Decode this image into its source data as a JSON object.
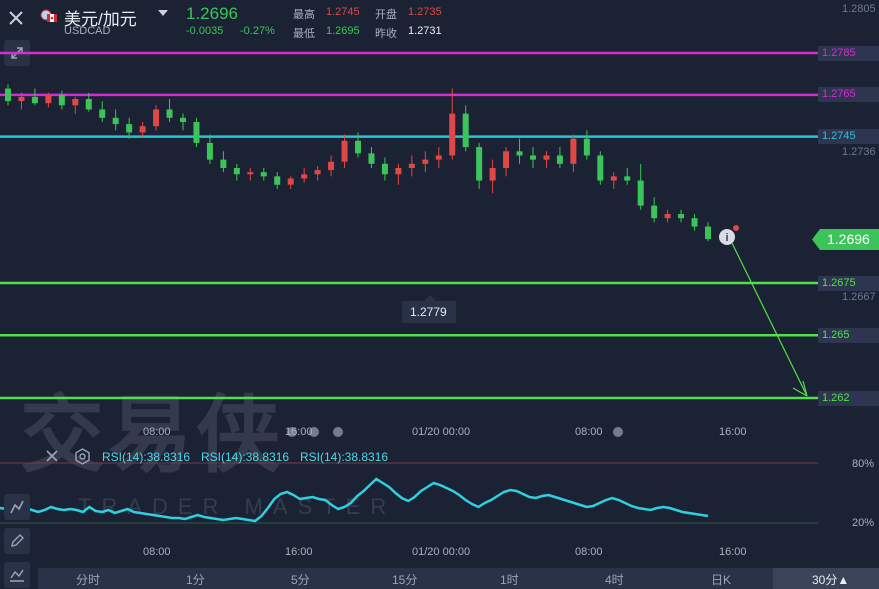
{
  "header": {
    "pair_name": "美元/加元",
    "pair_code": "USDCAD",
    "last_price": "1.2696",
    "change": "-0.0035",
    "change_pct": "-0.27%",
    "high_label": "最高",
    "high_value": "1.2745",
    "open_label": "开盘",
    "open_value": "1.2735",
    "low_label": "最低",
    "low_value": "1.2695",
    "prev_close_label": "昨收",
    "prev_close_value": "1.2731"
  },
  "price_axis": {
    "top_label": "1.2805",
    "labels": [
      {
        "text": "1.2785",
        "color": "#d62bd1"
      },
      {
        "text": "1.2765",
        "color": "#d62bd1"
      },
      {
        "text": "1.2745",
        "color": "#26c5d6"
      },
      {
        "text": "1.2736",
        "color": "#6e7890"
      },
      {
        "text": "1.2696",
        "color": "#3cc45a"
      },
      {
        "text": "1.2675",
        "color": "#3cc45a"
      },
      {
        "text": "1.2667",
        "color": "#6e7890"
      },
      {
        "text": "1.265",
        "color": "#3cc45a"
      },
      {
        "text": "1.262",
        "color": "#3cc45a"
      }
    ]
  },
  "tooltip_price": "1.2779",
  "time_axis_main": [
    "08:00",
    "16:00",
    "01/20 00:00",
    "08:00",
    "16:00"
  ],
  "time_axis_rsi": [
    "08:00",
    "16:00",
    "01/20 00:00",
    "08:00",
    "16:00"
  ],
  "rsi": {
    "labels": [
      "RSI(14):38.8316",
      "RSI(14):38.8316",
      "RSI(14):38.8316"
    ],
    "level_high": "80%",
    "level_low": "20%"
  },
  "watermark": {
    "main": "交易侠",
    "sub": "TRADER MASTER"
  },
  "timeframes": [
    "分时",
    "1分",
    "5分",
    "15分",
    "1时",
    "4时",
    "日K",
    "30分▲"
  ],
  "colors": {
    "magenta": "#d62bd1",
    "cyan": "#26c5d6",
    "green": "#52e04a",
    "up": "#3cc45a",
    "down": "#e04848"
  },
  "chart_data": {
    "type": "candlestick",
    "candles_ohlc": [
      [
        1.2768,
        1.277,
        1.276,
        1.2762
      ],
      [
        1.2762,
        1.2766,
        1.2758,
        1.2764
      ],
      [
        1.2764,
        1.2768,
        1.276,
        1.2761
      ],
      [
        1.2761,
        1.2766,
        1.2759,
        1.2765
      ],
      [
        1.2765,
        1.2767,
        1.2758,
        1.276
      ],
      [
        1.276,
        1.2764,
        1.2756,
        1.2763
      ],
      [
        1.2763,
        1.2766,
        1.2757,
        1.2758
      ],
      [
        1.2758,
        1.2762,
        1.2752,
        1.2754
      ],
      [
        1.2754,
        1.2758,
        1.2748,
        1.2751
      ],
      [
        1.2751,
        1.2754,
        1.2744,
        1.2747
      ],
      [
        1.2747,
        1.2752,
        1.2745,
        1.275
      ],
      [
        1.275,
        1.276,
        1.2748,
        1.2758
      ],
      [
        1.2758,
        1.2763,
        1.2752,
        1.2754
      ],
      [
        1.2754,
        1.2756,
        1.2748,
        1.2752
      ],
      [
        1.2752,
        1.2754,
        1.274,
        1.2742
      ],
      [
        1.2742,
        1.2746,
        1.2732,
        1.2734
      ],
      [
        1.2734,
        1.2738,
        1.2728,
        1.273
      ],
      [
        1.273,
        1.2732,
        1.2724,
        1.2727
      ],
      [
        1.2727,
        1.273,
        1.2724,
        1.2728
      ],
      [
        1.2728,
        1.273,
        1.2724,
        1.2726
      ],
      [
        1.2726,
        1.2728,
        1.272,
        1.2722
      ],
      [
        1.2722,
        1.2726,
        1.272,
        1.2725
      ],
      [
        1.2725,
        1.273,
        1.2723,
        1.2727
      ],
      [
        1.2727,
        1.2731,
        1.2724,
        1.2729
      ],
      [
        1.2729,
        1.2736,
        1.2726,
        1.2733
      ],
      [
        1.2733,
        1.2746,
        1.273,
        1.2743
      ],
      [
        1.2743,
        1.2747,
        1.2735,
        1.2737
      ],
      [
        1.2737,
        1.274,
        1.273,
        1.2732
      ],
      [
        1.2732,
        1.2735,
        1.2724,
        1.2727
      ],
      [
        1.2727,
        1.2732,
        1.2722,
        1.273
      ],
      [
        1.273,
        1.2736,
        1.2726,
        1.2732
      ],
      [
        1.2732,
        1.2738,
        1.2728,
        1.2734
      ],
      [
        1.2734,
        1.274,
        1.273,
        1.2736
      ],
      [
        1.2736,
        1.2768,
        1.2734,
        1.2756
      ],
      [
        1.2756,
        1.276,
        1.2738,
        1.274
      ],
      [
        1.274,
        1.2742,
        1.272,
        1.2724
      ],
      [
        1.2724,
        1.2734,
        1.2718,
        1.273
      ],
      [
        1.273,
        1.274,
        1.2726,
        1.2738
      ],
      [
        1.2738,
        1.2744,
        1.2732,
        1.2736
      ],
      [
        1.2736,
        1.274,
        1.273,
        1.2734
      ],
      [
        1.2734,
        1.2738,
        1.273,
        1.2736
      ],
      [
        1.2736,
        1.274,
        1.273,
        1.2732
      ],
      [
        1.2732,
        1.2746,
        1.2728,
        1.2744
      ],
      [
        1.2744,
        1.2748,
        1.2734,
        1.2736
      ],
      [
        1.2736,
        1.2738,
        1.2722,
        1.2724
      ],
      [
        1.2724,
        1.2728,
        1.272,
        1.2726
      ],
      [
        1.2726,
        1.273,
        1.2722,
        1.2724
      ],
      [
        1.2724,
        1.2732,
        1.271,
        1.2712
      ],
      [
        1.2712,
        1.2716,
        1.2704,
        1.2706
      ],
      [
        1.2706,
        1.271,
        1.2704,
        1.2708
      ],
      [
        1.2708,
        1.271,
        1.2704,
        1.2706
      ],
      [
        1.2706,
        1.2708,
        1.27,
        1.2702
      ],
      [
        1.2702,
        1.2704,
        1.2695,
        1.2696
      ]
    ],
    "horizontal_levels": [
      {
        "value": 1.2785,
        "color": "#d62bd1"
      },
      {
        "value": 1.2765,
        "color": "#d62bd1"
      },
      {
        "value": 1.2745,
        "color": "#26c5d6"
      },
      {
        "value": 1.2675,
        "color": "#52e04a"
      },
      {
        "value": 1.265,
        "color": "#52e04a"
      },
      {
        "value": 1.262,
        "color": "#52e04a"
      }
    ],
    "rsi_values": [
      35,
      34,
      36,
      33,
      35,
      33,
      31,
      33,
      36,
      34,
      33,
      34,
      33,
      31,
      36,
      32,
      31,
      33,
      30,
      32,
      34,
      31,
      30,
      29,
      28,
      27,
      26,
      25,
      25,
      24,
      26,
      28,
      26,
      25,
      24,
      23,
      24,
      25,
      24,
      23,
      22,
      27,
      35,
      44,
      49,
      51,
      48,
      44,
      45,
      46,
      44,
      43,
      38,
      34,
      36,
      40,
      47,
      52,
      58,
      64,
      60,
      56,
      50,
      45,
      42,
      46,
      52,
      56,
      60,
      58,
      55,
      52,
      48,
      43,
      39,
      36,
      40,
      43,
      47,
      51,
      53,
      52,
      49,
      46,
      45,
      47,
      48,
      46,
      44,
      42,
      40,
      38,
      36,
      37,
      40,
      43,
      45,
      43,
      40,
      37,
      35,
      34,
      33,
      35,
      36,
      35,
      33,
      31,
      30,
      29,
      28,
      27
    ]
  }
}
